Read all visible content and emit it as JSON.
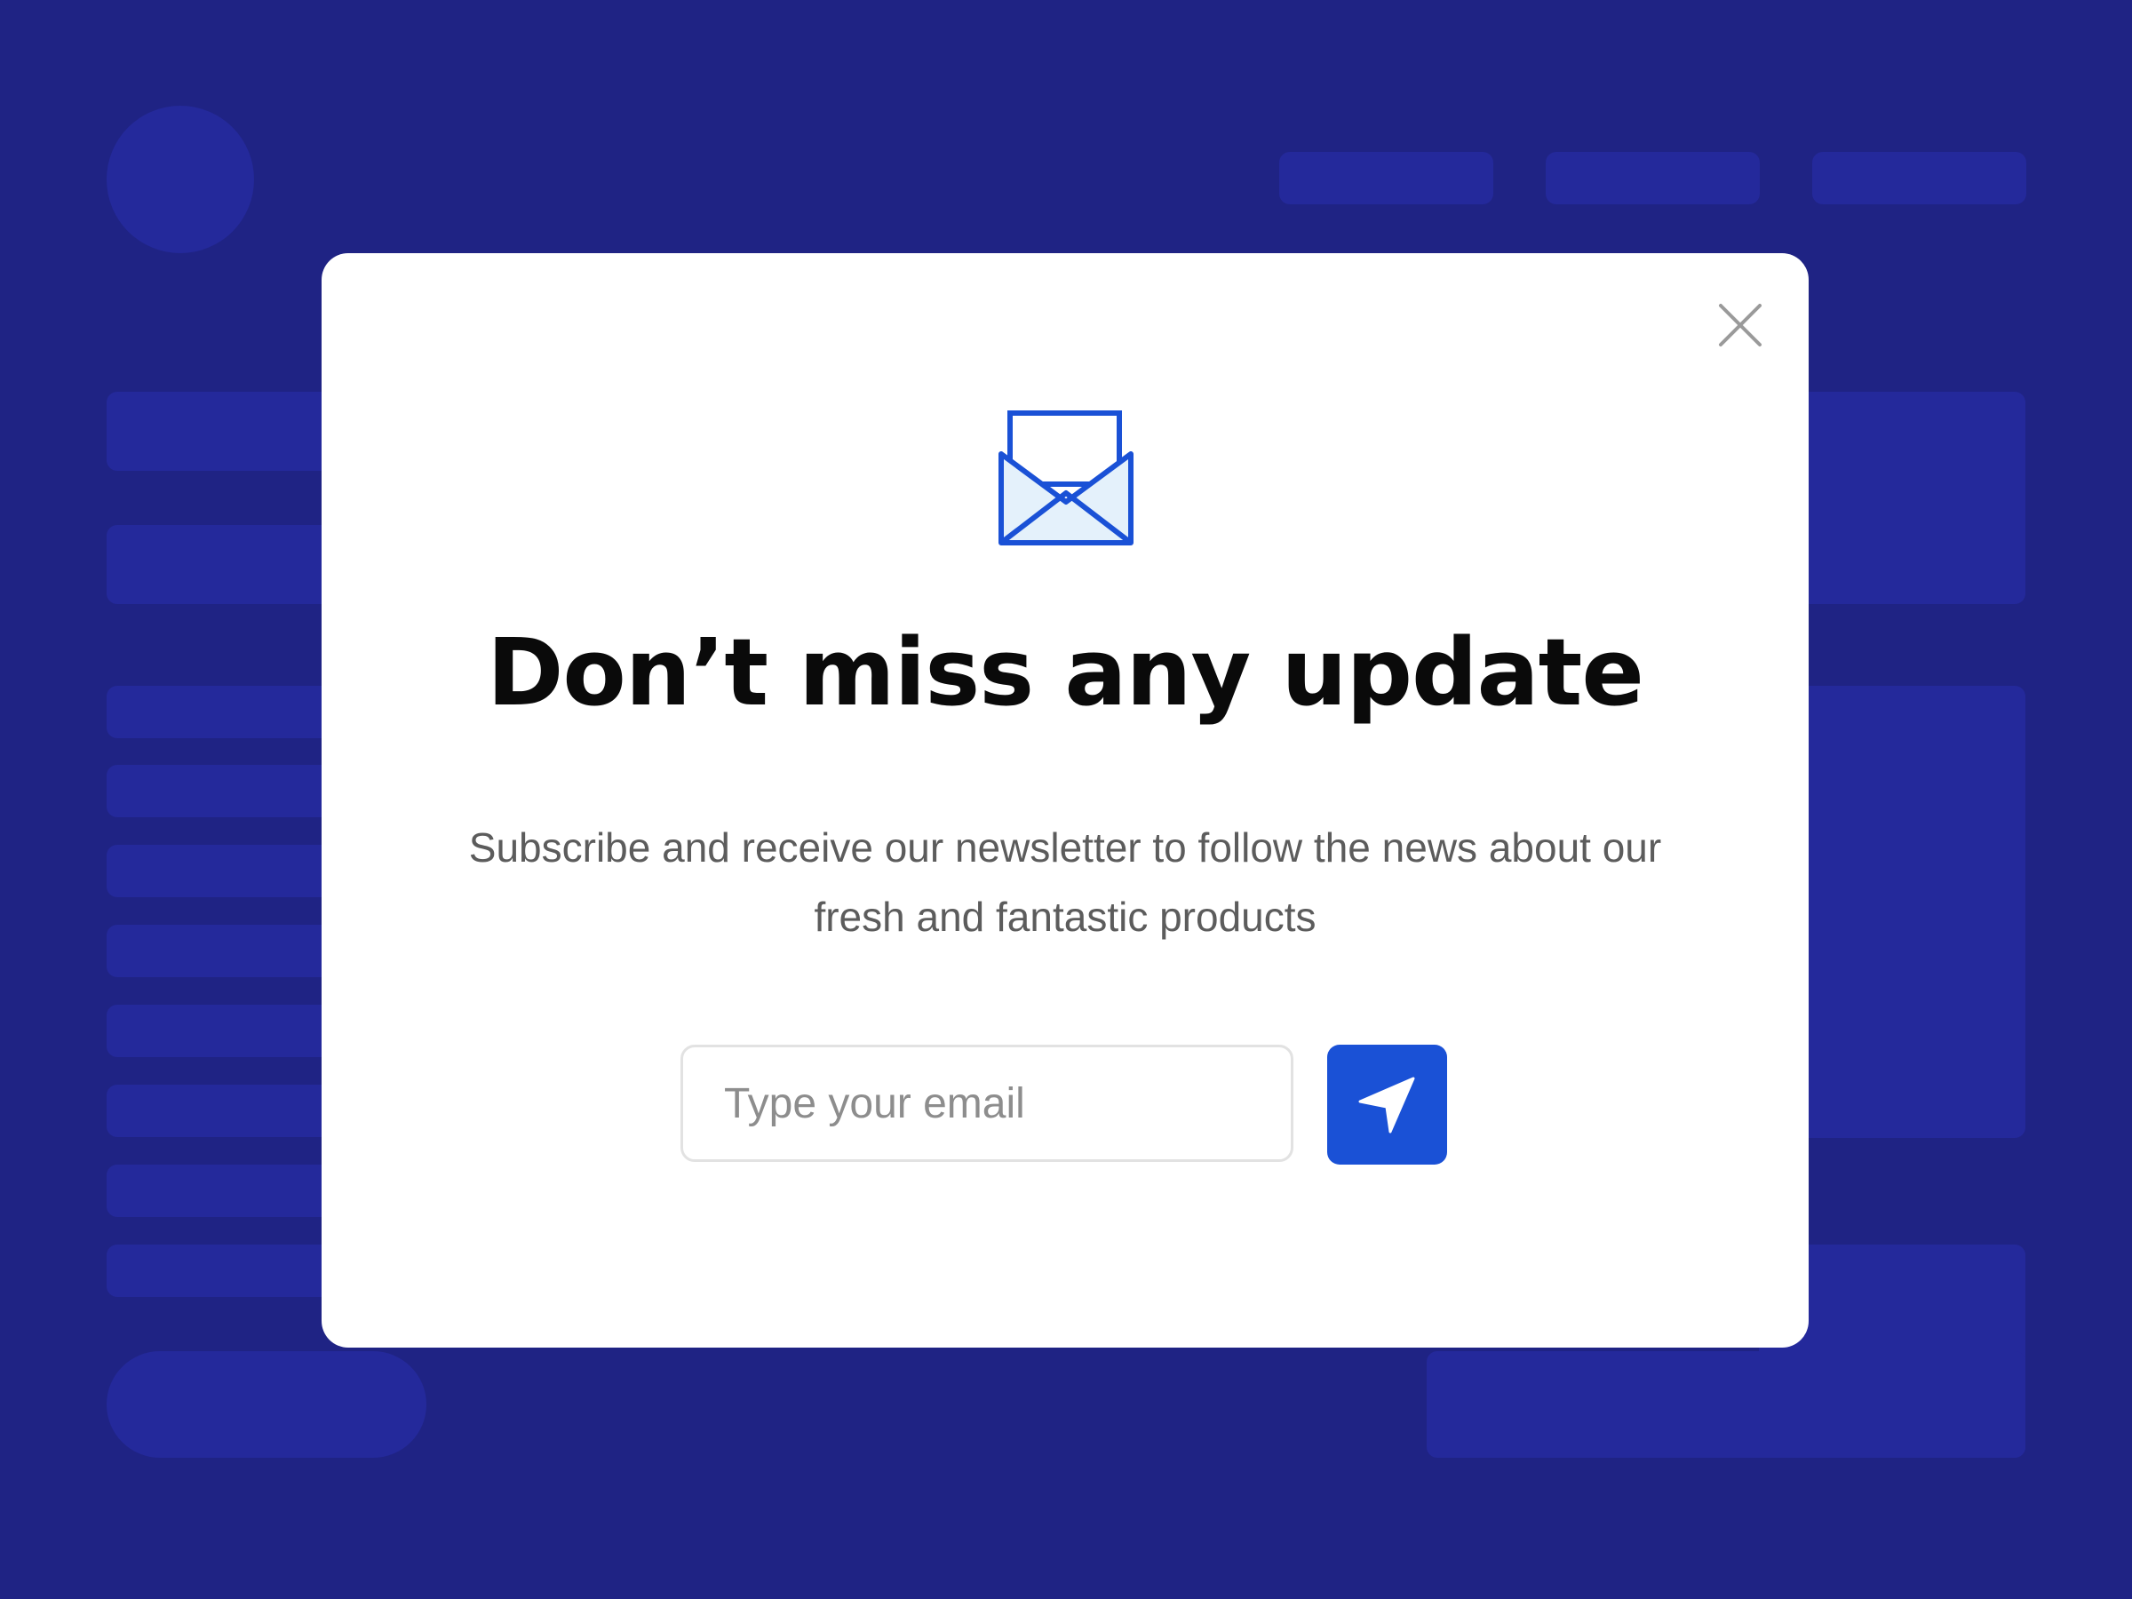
{
  "background": {
    "color": "#1f2384",
    "placeholder_color": "#24299b"
  },
  "modal": {
    "title": "Don’t miss any update",
    "subtitle": "Subscribe and receive our newsletter to follow the news about our fresh and fantastic products",
    "email_input": {
      "placeholder": "Type your email",
      "value": ""
    },
    "icons": {
      "close": "close-icon",
      "envelope": "envelope-open-icon",
      "send": "send-arrow-icon"
    },
    "colors": {
      "accent": "#1a51d6",
      "envelope_fill": "#e4f1fb",
      "close": "#9a9a9a"
    }
  }
}
